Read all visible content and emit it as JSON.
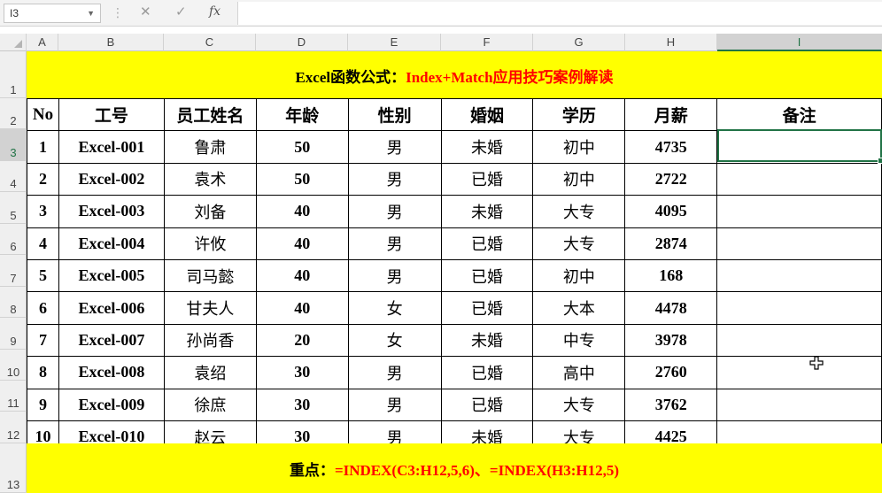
{
  "formula_bar": {
    "name_box": "I3",
    "cancel_icon": "✕",
    "enter_icon": "✓",
    "fx_label": "fx",
    "formula": ""
  },
  "columns": [
    "A",
    "B",
    "C",
    "D",
    "E",
    "F",
    "G",
    "H",
    "I"
  ],
  "selected_column": "I",
  "rows": [
    "1",
    "2",
    "3",
    "4",
    "5",
    "6",
    "7",
    "8",
    "9",
    "10",
    "11",
    "12",
    "13"
  ],
  "selected_row": "3",
  "title": {
    "prefix": "Excel函数公式：",
    "highlight": "Index+Match应用技巧案例解读"
  },
  "table": {
    "headers": [
      "No",
      "工号",
      "员工姓名",
      "年龄",
      "性别",
      "婚姻",
      "学历",
      "月薪",
      "备注"
    ],
    "rows": [
      [
        "1",
        "Excel-001",
        "鲁肃",
        "50",
        "男",
        "未婚",
        "初中",
        "4735",
        ""
      ],
      [
        "2",
        "Excel-002",
        "袁术",
        "50",
        "男",
        "已婚",
        "初中",
        "2722",
        ""
      ],
      [
        "3",
        "Excel-003",
        "刘备",
        "40",
        "男",
        "未婚",
        "大专",
        "4095",
        ""
      ],
      [
        "4",
        "Excel-004",
        "许攸",
        "40",
        "男",
        "已婚",
        "大专",
        "2874",
        ""
      ],
      [
        "5",
        "Excel-005",
        "司马懿",
        "40",
        "男",
        "已婚",
        "初中",
        "168",
        ""
      ],
      [
        "6",
        "Excel-006",
        "甘夫人",
        "40",
        "女",
        "已婚",
        "大本",
        "4478",
        ""
      ],
      [
        "7",
        "Excel-007",
        "孙尚香",
        "20",
        "女",
        "未婚",
        "中专",
        "3978",
        ""
      ],
      [
        "8",
        "Excel-008",
        "袁绍",
        "30",
        "男",
        "已婚",
        "高中",
        "2760",
        ""
      ],
      [
        "9",
        "Excel-009",
        "徐庶",
        "30",
        "男",
        "已婚",
        "大专",
        "3762",
        ""
      ],
      [
        "10",
        "Excel-010",
        "赵云",
        "30",
        "男",
        "未婚",
        "大专",
        "4425",
        ""
      ]
    ]
  },
  "footer": {
    "prefix": "重点：",
    "formula": "=INDEX(C3:H12,5,6)、=INDEX(H3:H12,5)"
  },
  "colors": {
    "band": "#ffff00",
    "highlight_text": "#ff0000",
    "selection": "#217346"
  }
}
